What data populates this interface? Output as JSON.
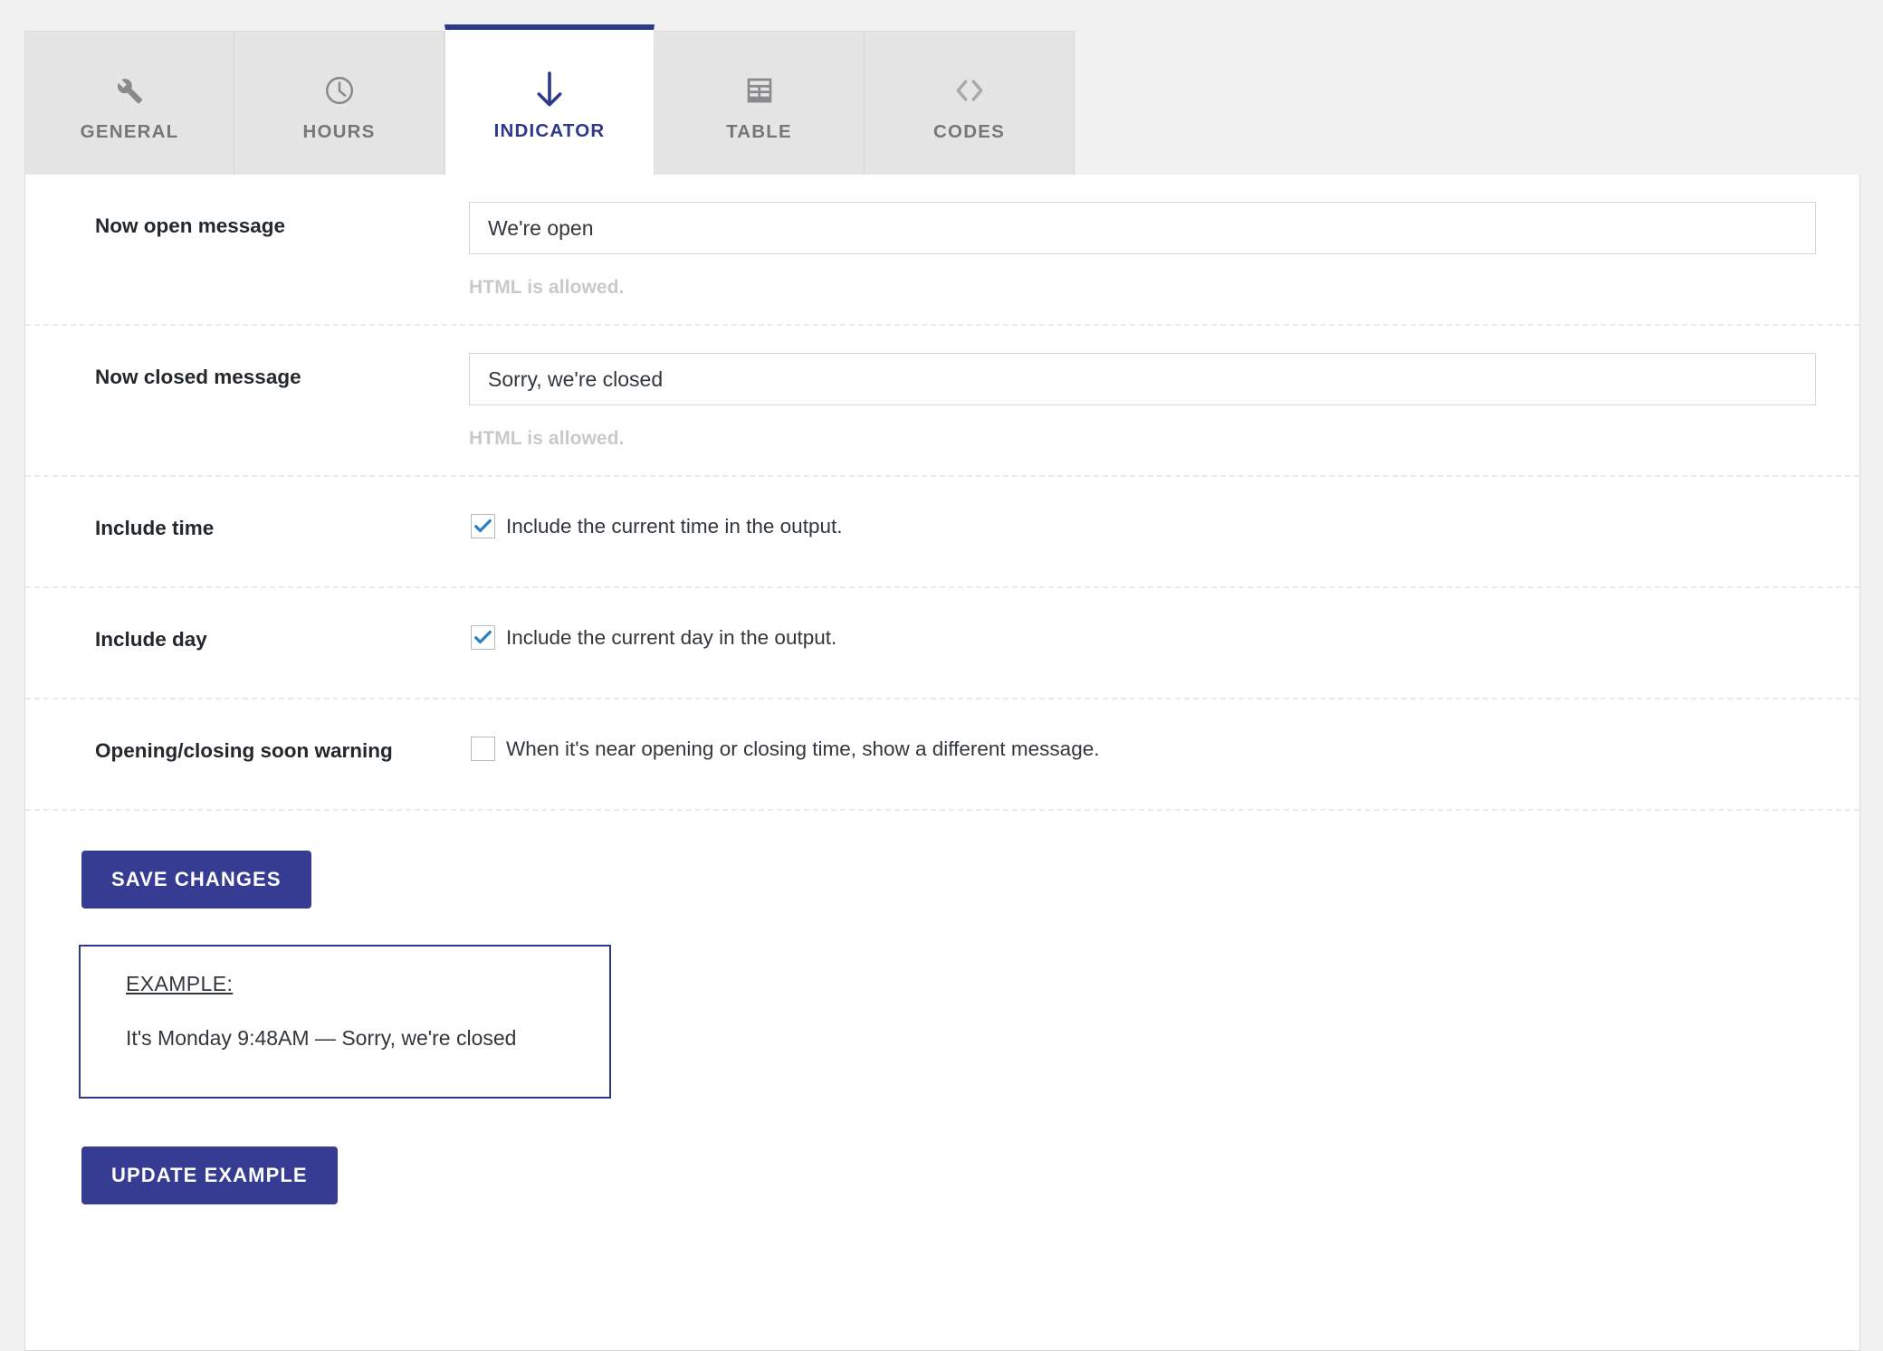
{
  "tabs": [
    {
      "label": "GENERAL",
      "icon": "wrench-icon",
      "active": false
    },
    {
      "label": "HOURS",
      "icon": "clock-icon",
      "active": false
    },
    {
      "label": "INDICATOR",
      "icon": "arrow-down-icon",
      "active": true
    },
    {
      "label": "TABLE",
      "icon": "table-grid-icon",
      "active": false
    },
    {
      "label": "CODES",
      "icon": "angle-brackets-icon",
      "active": false
    }
  ],
  "form": {
    "now_open": {
      "label": "Now open message",
      "value": "We're open",
      "placeholder": "",
      "helper": "HTML is allowed."
    },
    "now_closed": {
      "label": "Now closed message",
      "value": "Sorry, we're closed",
      "placeholder": "",
      "helper": "HTML is allowed."
    },
    "include_time": {
      "label": "Include time",
      "checkbox_text": "Include the current time in the output.",
      "checked": true
    },
    "include_day": {
      "label": "Include day",
      "checkbox_text": "Include the current day in the output.",
      "checked": true
    },
    "soon_warning": {
      "label": "Opening/closing soon warning",
      "checkbox_text": "When it's near opening or closing time, show a different message.",
      "checked": false
    }
  },
  "buttons": {
    "save": "SAVE CHANGES",
    "update_example": "UPDATE EXAMPLE"
  },
  "example": {
    "title": "EXAMPLE:",
    "text": "It's Monday 9:48AM — Sorry, we're closed"
  },
  "colors": {
    "accent": "#2d3a8c",
    "button": "#363c91",
    "tab_inactive_bg": "#e5e5e5",
    "tab_label_inactive": "#76767b",
    "checkmark": "#2a7ec4",
    "helper_text": "#c9c9c9",
    "page_bg": "#f1f1f1"
  }
}
